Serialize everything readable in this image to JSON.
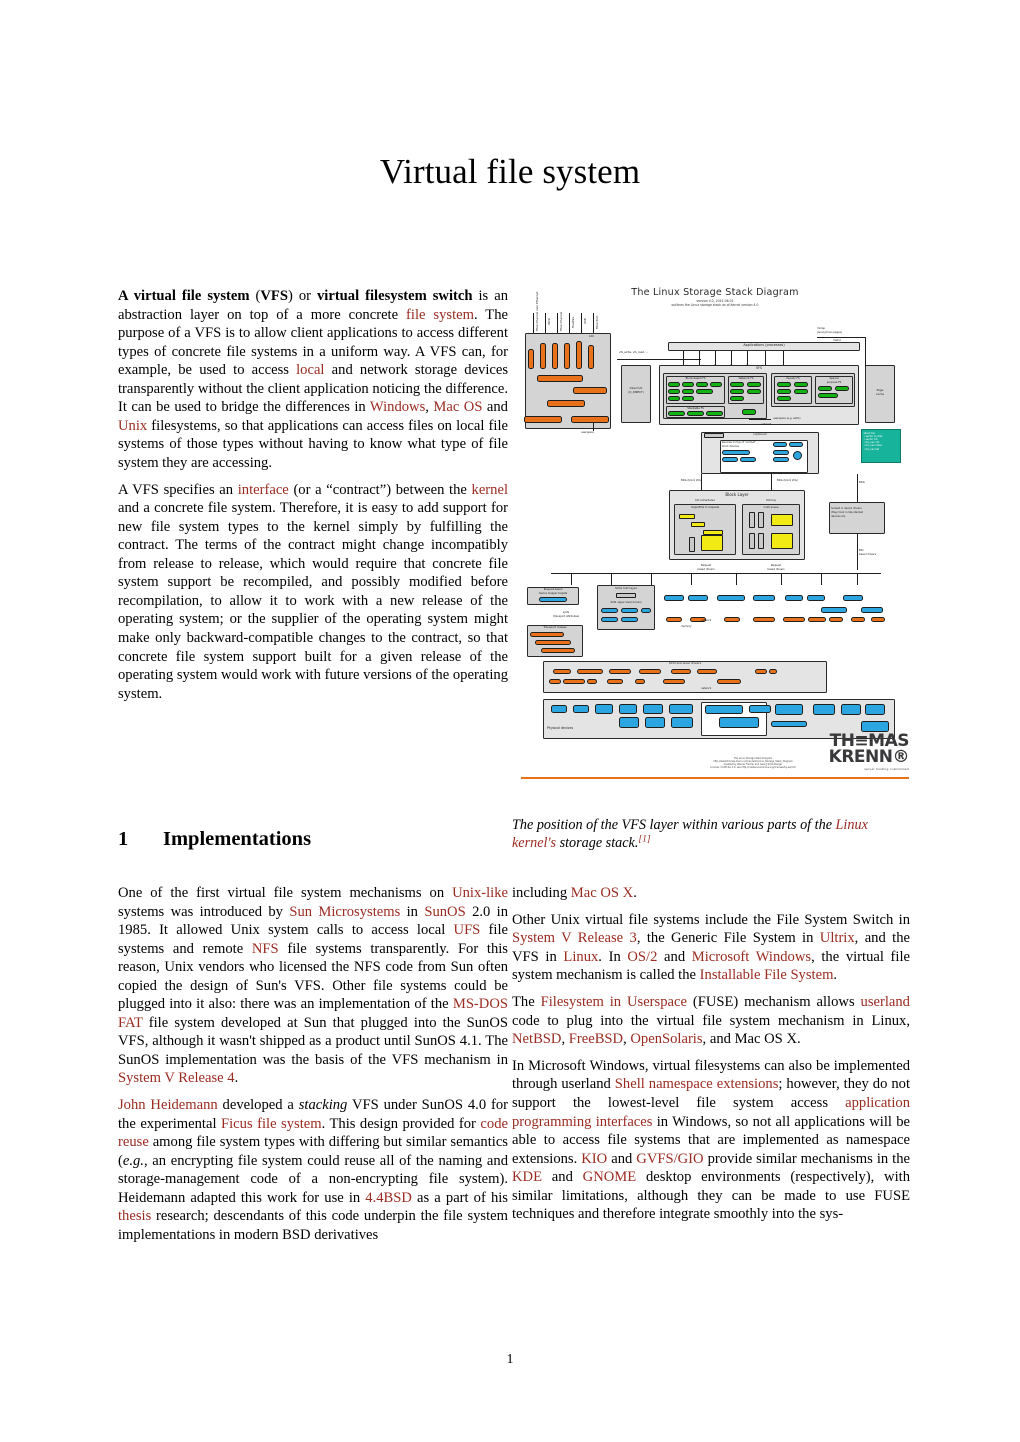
{
  "document": {
    "title": "Virtual file system",
    "page_number": "1",
    "link_color": "#9a2b20"
  },
  "intro": {
    "p1": {
      "bold1": "A virtual file system",
      "t1": " (",
      "bold2": "VFS",
      "t2": ") or ",
      "bold3": "virtual filesystem switch",
      "t3": " is an abstraction layer on top of a more concrete ",
      "link1": "file system",
      "t4": ". The purpose of a VFS is to allow client applications to access different types of concrete file systems in a uniform way. A VFS can, for example, be used to access ",
      "link2": "local",
      "t5": " and network storage devices transparently without the client application noticing the difference. It can be used to bridge the differences in ",
      "link3": "Windows",
      "t6": ", ",
      "link4": "Mac OS",
      "t7": " and ",
      "link5": "Unix",
      "t8": " filesystems, so that applications can access files on local file systems of those types without having to know what type of file system they are accessing."
    },
    "p2": {
      "t1": "A VFS specifies an ",
      "link1": "interface",
      "t2": " (or a “contract”) between the ",
      "link2": "kernel",
      "t3": " and a concrete file system. Therefore, it is easy to add support for new file system types to the kernel simply by fulfilling the contract. The terms of the contract might change incompatibly from release to release, which would require that concrete file system support be recompiled, and possibly modified before recompilation, to allow it to work with a new release of the operating system; or the supplier of the operating system might make only backward-compatible changes to the contract, so that concrete file system support built for a given release of the operating system would work with future versions of the operating system."
    }
  },
  "figure": {
    "caption": {
      "t1": "The position of the VFS layer within various parts of the ",
      "link1": "Linux kernel's",
      "t2": " storage stack.",
      "ref": "[1]"
    },
    "title": "The Linux Storage Stack Diagram",
    "subtitle_line1": "version 4.0, 2015-06-01",
    "subtitle_line2": "outlines the Linux storage stack as of Kernel version 4.0",
    "top_ports": [
      "Fibre Channel\nover Ethernet",
      "iSCSI",
      "Fibre Channel",
      "FireWire",
      "USB",
      "Fibre Port"
    ],
    "lio_group_label": "LIO",
    "lio_front_pills": [
      "tcm_fc",
      "iSCSI target",
      "tcm_qla2xxx",
      "tcm_fusion",
      "tcm_usb_gadget",
      "tcm_vhost"
    ],
    "lio_core_pills": [
      "target_core_mod",
      "target_core_file",
      "target_core_iblock",
      "target_core_pscsi",
      "target_core_user"
    ],
    "applications_label": "Applications (processes)",
    "syscalls": [
      "stat(2)",
      "read(2)",
      "open(2)",
      "write(2)",
      "chmod(2)",
      "..."
    ],
    "mmap_label": "mmap\n(anonymous pages)",
    "malloc_label": "malloc",
    "vfs_calls_label": "vfs_write, vfs_read, ...",
    "direct_io_label": "Direct I/O\n(O_DIRECT)",
    "vfs_label": "VFS",
    "fs_groups": [
      {
        "name": "Block-based FS",
        "items": [
          "ext2",
          "ext3",
          "ext4",
          "xfs",
          "btrfs",
          "ifs",
          "iso9660",
          "gfs",
          "ocfs",
          "..."
        ]
      },
      {
        "name": "Network FS",
        "items": [
          "NFS",
          "coda",
          "smbfs",
          "...",
          "ceph"
        ]
      },
      {
        "name": "Pseudo FS",
        "items": [
          "proc",
          "sysfs",
          "pipefs",
          "futexfs",
          "usbfs",
          "..."
        ]
      },
      {
        "name": "Special purpose FS",
        "items": [
          "tmpfs",
          "ramfs",
          "devtmpfs"
        ]
      },
      {
        "name": "Stackable FS",
        "items": [
          "ecryptfs",
          "overlayfs",
          "unionfs"
        ]
      }
    ],
    "fuse_pill": "FUSE",
    "userspace_label": "userspace (e.g. sshfs)",
    "network_label": "network",
    "page_cache_label": "Page cache",
    "struct_bio_note": "struct bio\n- sector on disk\n- sector cnt\n- bio_vec cnt\n- bio_vec index\n- bio_vec list",
    "optional_label": "(optional)",
    "stackable_label": "stackable",
    "devices_label": "Devices on top of \"normal\"\nblock devices",
    "dm_pills": [
      "device mapper",
      "mdraid",
      "linear",
      "dm-crypt",
      "multipath",
      "..."
    ],
    "bios_label": "BIOs (block I/Os)",
    "block_layer_label": "Block Layer",
    "io_sched_label": "I/O scheduler",
    "maps_bios_label": "maps BIOs to requests",
    "sched_pills": [
      "noop",
      "cfq",
      "deadline"
    ],
    "blkmq_label": "blkmq",
    "multi_queue_label": "multi queue",
    "yellow_boxes": [
      "Hardware dispatch queues",
      "Software queues",
      "Hardware dispatch queues"
    ],
    "request_based_drivers": "Request-based drivers",
    "hooked_note": "hooked in device drivers\n(they hook in like stacked\ndevices do)",
    "bio_based_drivers": "BIO-based drivers",
    "req_dm_label": "Request-based\ndevice mapper targets",
    "req_dm_pill": "dm-multipath",
    "sysfs_label": "sysfs\n(transport attributes)",
    "transport_classes_label": "Transport classes",
    "transport_pills": [
      "scsi_transport_fc",
      "scsi_transport_sas",
      "scsi_transport_..."
    ],
    "scsi_mid_label": "SCSI mid layer",
    "scsi_mq_pill": "scsi-mq",
    "scsi_upper_label": "SCSI upper level drivers",
    "scsi_upper_pills": [
      "/dev/sda",
      "/dev/sdb",
      "...",
      "/dev/sr*",
      "/dev/st*"
    ],
    "devnodes": [
      "/dev/rssd*",
      "/dev/rbd*",
      "/dev/nvme#n#",
      "/dev/skd*",
      "/dev/vd*",
      "/dev/nvd*",
      "/dev/mmcblk*p*",
      "/dev/rsxx*"
    ],
    "scsi_low_label": "SCSI low level drivers",
    "scsi_low_pills": [
      "libata",
      "megaraid_sas",
      "aacraid",
      "qla2xxx",
      "lpfc",
      "ahci",
      "mtip32xx",
      "nvme",
      "rbd",
      "virtio_blk",
      "mmc",
      "skd",
      "..."
    ],
    "physical_label": "Physical devices",
    "physical_pills": [
      "SCSI",
      "SATA",
      "DVD RAM",
      "SAS\nRAID",
      "Adaptec RAID",
      "Qlogic HBA",
      "Emulex HBA",
      "PMC-Sierra HBA",
      "LSI 12Gb SAS HBA",
      "para-virtualized SCSI",
      "VMware's para-virtualized SCSI",
      "virtio_blk",
      "mobile device flash memory",
      "SD/MMC Card",
      "micron PCIe Card",
      "nvme SSD",
      "SMC SSD",
      "IBM flash adapter"
    ],
    "memory_label": "memory",
    "thomas_krenn": {
      "line1": "TH≡MAS",
      "line2": "KRENN®",
      "tagline": "server hosting customized"
    },
    "credit": "The Linux Storage Stack Diagram\nhttp://www.thomas-krenn.com/en/wiki/Linux_Storage_Stack_Diagram\nCreated by Werner Fischer and Georg Schönberger\nLicense: CC-BY-SA 3.0, see http://creativecommons.org/licenses/by-sa/3.0/"
  },
  "section1": {
    "number": "1",
    "title": "Implementations",
    "left": {
      "p1": {
        "t1": "One of the first virtual file system mechanisms on ",
        "link1": "Unix-like",
        "t2": " systems was introduced by ",
        "link2": "Sun Microsystems",
        "t3": " in ",
        "link3": "SunOS",
        "t4": " 2.0 in 1985. It allowed Unix system calls to access local ",
        "link4": "UFS",
        "t5": " file systems and remote ",
        "link5": "NFS",
        "t6": " file systems transparently. For this reason, Unix vendors who licensed the NFS code from Sun often copied the design of Sun's VFS. Other file systems could be plugged into it also: there was an implementation of the ",
        "link6": "MS-DOS FAT",
        "t7": " file system developed at Sun that plugged into the SunOS VFS, although it wasn't shipped as a product until SunOS 4.1. The SunOS implementation was the basis of the VFS mechanism in ",
        "link7": "System V Release 4",
        "t8": "."
      },
      "p2": {
        "link1": "John Heidemann",
        "t1": " developed a ",
        "em1": "stacking",
        "t2": " VFS under SunOS 4.0 for the experimental ",
        "link2": "Ficus file system",
        "t3": ". This design provided for ",
        "link3": "code reuse",
        "t4": " among file system types with differing but similar semantics (",
        "em2": "e.g.",
        "t5": ", an encrypting file system could reuse all of the naming and storage-management code of a non-encrypting file system). Heidemann adapted this work for use in ",
        "link4": "4.4BSD",
        "t6": " as a part of his ",
        "link5": "thesis",
        "t7": " research; descendants of this code underpin the file system implementations in modern BSD derivatives"
      }
    },
    "right": {
      "p0": {
        "t1": "including ",
        "link1": "Mac OS X",
        "t2": "."
      },
      "p1": {
        "t1": "Other Unix virtual file systems include the File System Switch in ",
        "link1": "System V Release 3",
        "t2": ", the Generic File System in ",
        "link2": "Ultrix",
        "t3": ", and the VFS in ",
        "link3": "Linux",
        "t4": ". In ",
        "link4": "OS/2",
        "t5": " and ",
        "link5": "Microsoft Windows",
        "t6": ", the virtual file system mechanism is called the ",
        "link6": "Installable File System",
        "t7": "."
      },
      "p2": {
        "t1": "The ",
        "link1": "Filesystem in Userspace",
        "t2": " (FUSE) mechanism allows ",
        "link2": "userland",
        "t3": " code to plug into the virtual file system mechanism in Linux, ",
        "link3": "NetBSD",
        "t4": ", ",
        "link4": "FreeBSD",
        "t5": ", ",
        "link5": "OpenSolaris",
        "t6": ", and Mac OS X."
      },
      "p3": {
        "t1": "In Microsoft Windows, virtual filesystems can also be implemented through userland ",
        "link1": "Shell namespace extensions",
        "t2": "; however, they do not support the lowest-level file system access ",
        "link2": "application programming interfaces",
        "t3": " in Windows, so not all applications will be able to access file systems that are implemented as namespace extensions. ",
        "link3": "KIO",
        "t4": " and ",
        "link4": "GVFS/GIO",
        "t5": " provide similar mechanisms in the ",
        "link5": "KDE",
        "t6": " and ",
        "link6": "GNOME",
        "t7": " desktop environments (respectively), with similar limitations, although they can be made to use FUSE techniques and therefore integrate smoothly into the sys-"
      }
    }
  }
}
